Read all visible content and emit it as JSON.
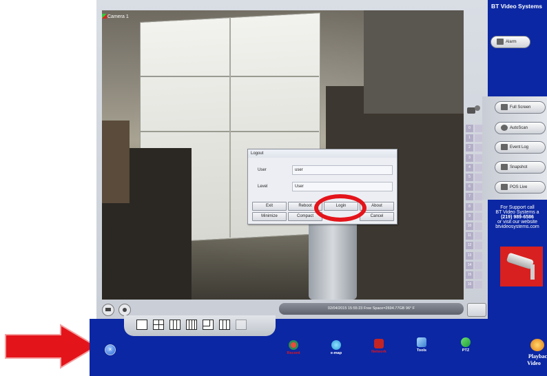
{
  "camera": {
    "label": "Camera 1"
  },
  "status_bar": {
    "text": "02/04/2015 15:55:23  Free Space=2694.77GB 96° F"
  },
  "dialog": {
    "title": "Logout",
    "user_label": "User",
    "user_value": "user",
    "level_label": "Level",
    "level_value": "User",
    "buttons": {
      "exit": "Exit",
      "reboot": "Reboot",
      "login": "Login",
      "about": "About",
      "minimize": "Minimize",
      "compact": "Compact",
      "cancel": "Cancel"
    }
  },
  "camera_numbers": [
    "0",
    "1",
    "2",
    "3",
    "4",
    "5",
    "6",
    "7",
    "8",
    "9",
    "10",
    "11",
    "12",
    "13",
    "14",
    "15",
    "16"
  ],
  "right_panel": {
    "brand": "BT Video Systems",
    "alarm": "Alarm",
    "full_screen": "Full Screen",
    "autoscan": "AutoScan",
    "event_log": "Event Log",
    "snapshot": "Snapshot",
    "pos_live": "POS Live",
    "support": [
      "For Support call",
      "BT Video Systems a",
      "(219) 989-6586",
      "or visit our website",
      "btvideosystems.com"
    ],
    "playback": [
      "Playbac",
      "Video"
    ]
  },
  "toolbar": {
    "record": "Record",
    "emap": "e-map",
    "network": "Network",
    "tools": "Tools",
    "ptz": "PTZ"
  },
  "colors": {
    "panel_blue": "#0b27a3",
    "annotation_red": "#e4141b",
    "silver": "#cfd3da"
  },
  "icons": [
    "annotation-arrow",
    "camera-icon",
    "close-icon",
    "record-icon",
    "emap-icon",
    "network-icon",
    "tools-icon",
    "ptz-icon",
    "playback-icon",
    "security-camera-icon"
  ]
}
